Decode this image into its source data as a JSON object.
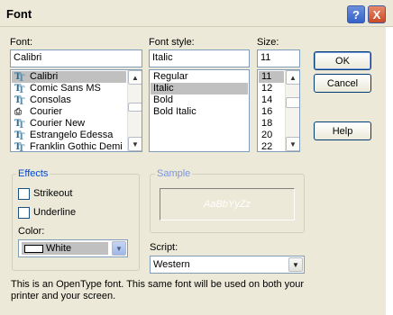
{
  "window": {
    "title": "Font",
    "help_glyph": "?",
    "close_glyph": "X"
  },
  "font": {
    "label": "Font:",
    "value": "Calibri",
    "items": [
      {
        "name": "Calibri",
        "icon": "truetype-font-icon",
        "selected": true
      },
      {
        "name": "Comic Sans MS",
        "icon": "truetype-font-icon",
        "selected": false
      },
      {
        "name": "Consolas",
        "icon": "truetype-font-icon",
        "selected": false
      },
      {
        "name": "Courier",
        "icon": "printer-font-icon",
        "selected": false
      },
      {
        "name": "Courier New",
        "icon": "truetype-font-icon",
        "selected": false
      },
      {
        "name": "Estrangelo Edessa",
        "icon": "truetype-font-icon",
        "selected": false
      },
      {
        "name": "Franklin Gothic Demi",
        "icon": "truetype-font-icon",
        "selected": false
      }
    ]
  },
  "style": {
    "label": "Font style:",
    "value": "Italic",
    "items": [
      {
        "name": "Regular",
        "selected": false
      },
      {
        "name": "Italic",
        "selected": true
      },
      {
        "name": "Bold",
        "selected": false
      },
      {
        "name": "Bold Italic",
        "selected": false
      }
    ]
  },
  "size": {
    "label": "Size:",
    "value": "11",
    "items": [
      {
        "name": "11",
        "selected": true
      },
      {
        "name": "12",
        "selected": false
      },
      {
        "name": "14",
        "selected": false
      },
      {
        "name": "16",
        "selected": false
      },
      {
        "name": "18",
        "selected": false
      },
      {
        "name": "20",
        "selected": false
      },
      {
        "name": "22",
        "selected": false
      }
    ]
  },
  "buttons": {
    "ok": "OK",
    "cancel": "Cancel",
    "help": "Help"
  },
  "effects": {
    "title": "Effects",
    "strikeout": "Strikeout",
    "underline": "Underline",
    "strikeout_checked": false,
    "underline_checked": false,
    "color_label": "Color:",
    "color_value": "White",
    "color_swatch": "#ffffff"
  },
  "sample": {
    "title": "Sample",
    "text": "AaBbYyZz"
  },
  "script": {
    "label": "Script:",
    "value": "Western"
  },
  "description": {
    "line1": "This is an OpenType font. This same font will be used on both your",
    "line2": "printer and your screen."
  },
  "colors": {
    "dialog_bg": "#ece9d8",
    "selection": "#c0c0c0",
    "groupbox_title": "#0046d5",
    "field_border": "#7f9db9"
  },
  "icons": {
    "scroll_up": "scroll-up-arrow-icon",
    "scroll_down": "scroll-down-arrow-icon",
    "dropdown": "chevron-down-icon"
  }
}
